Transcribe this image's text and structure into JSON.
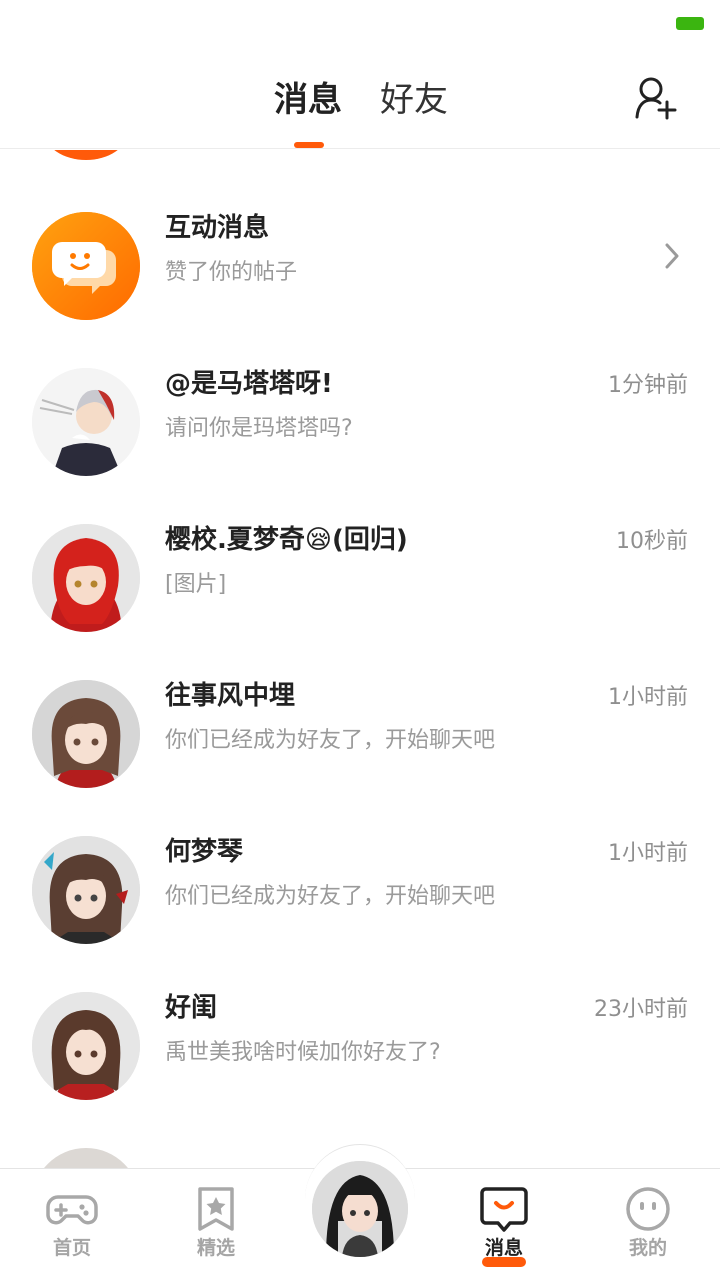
{
  "header": {
    "tabs": [
      {
        "label": "消息",
        "active": true
      },
      {
        "label": "好友",
        "active": false
      }
    ],
    "add_friend_icon": "add-user-icon"
  },
  "colors": {
    "accent": "#ff5a0a",
    "battery": "#3bb510",
    "title_text": "#222222",
    "sub_text": "#9a9a9a"
  },
  "conversations": [
    {
      "title": "互动消息",
      "subtitle": "赞了你的帖子",
      "time": "",
      "avatar": "interaction-icon"
    },
    {
      "title": "@是马塔塔呀!",
      "subtitle": "请问你是玛塔塔吗?",
      "time": "1分钟前",
      "avatar": "avatar"
    },
    {
      "title": "樱校.夏梦奇😪(回归)",
      "subtitle": "[图片]",
      "time": "10秒前",
      "avatar": "avatar"
    },
    {
      "title": "往事风中埋",
      "subtitle": "你们已经成为好友了，开始聊天吧",
      "time": "1小时前",
      "avatar": "avatar"
    },
    {
      "title": "何梦琴",
      "subtitle": "你们已经成为好友了，开始聊天吧",
      "time": "1小时前",
      "avatar": "avatar"
    },
    {
      "title": "好闺",
      "subtitle": "禹世美我啥时候加你好友了?",
      "time": "23小时前",
      "avatar": "avatar"
    }
  ],
  "bottom_nav": [
    {
      "label": "首页",
      "icon": "gamepad-icon",
      "active": false
    },
    {
      "label": "精选",
      "icon": "star-bookmark-icon",
      "active": false
    },
    {
      "label": "",
      "icon": "profile-avatar",
      "active": false
    },
    {
      "label": "消息",
      "icon": "chat-bubble-icon",
      "active": true
    },
    {
      "label": "我的",
      "icon": "smiley-face-icon",
      "active": false
    }
  ]
}
